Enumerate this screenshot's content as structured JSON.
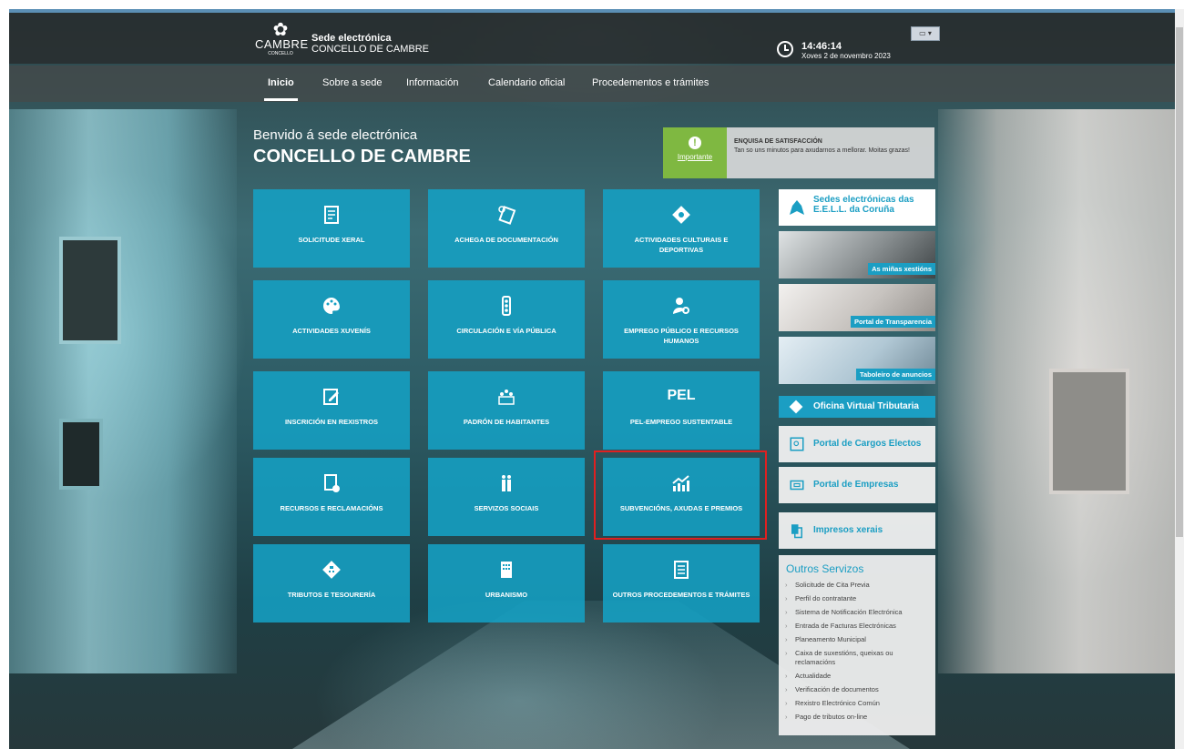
{
  "header": {
    "logo_text": "CAMBRE",
    "logo_sub": "CONCELLO",
    "site_title_1": "Sede electrónica",
    "site_title_2": "CONCELLO DE CAMBRE",
    "time": "14:46:14",
    "date": "Xoves 2 de novembro 2023",
    "language": "GL"
  },
  "nav": {
    "items": [
      "Inicio",
      "Sobre a sede",
      "Información",
      "Calendario oficial",
      "Procedementos e trámites"
    ]
  },
  "welcome": {
    "line1": "Benvido á sede electrónica",
    "line2": "CONCELLO DE CAMBRE"
  },
  "survey": {
    "badge": "Importante",
    "title": "ENQUISA DE SATISFACCIÓN",
    "text": "Tan so uns minutos para axudarnos a mellorar. Moitas grazas!"
  },
  "tiles": [
    {
      "label": "SOLICITUDE XERAL",
      "icon": "document-icon"
    },
    {
      "label": "ACHEGA DE DOCUMENTACIÓN",
      "icon": "documents-icon"
    },
    {
      "label": "ACTIVIDADES CULTURAIS E DEPORTIVAS",
      "icon": "ticket-icon"
    },
    {
      "label": "ACTIVIDADES XUVENÍS",
      "icon": "palette-icon"
    },
    {
      "label": "CIRCULACIÓN E VÍA PÚBLICA",
      "icon": "traffic-light-icon"
    },
    {
      "label": "EMPREGO PÚBLICO E RECURSOS HUMANOS",
      "icon": "user-search-icon"
    },
    {
      "label": "INSCRICIÓN EN REXISTROS",
      "icon": "edit-icon"
    },
    {
      "label": "PADRÓN DE HABITANTES",
      "icon": "people-icon"
    },
    {
      "label": "PEL-EMPREGO SUSTENTABLE",
      "icon": "pel-text-icon",
      "icon_text": "PEL"
    },
    {
      "label": "RECURSOS E RECLAMACIÓNS",
      "icon": "document-clock-icon"
    },
    {
      "label": "SERVIZOS SOCIAIS",
      "icon": "family-icon"
    },
    {
      "label": "SUBVENCIÓNS, AXUDAS E PREMIOS",
      "icon": "growth-chart-icon"
    },
    {
      "label": "TRIBUTOS E TESOURERÍA",
      "icon": "calculator-icon"
    },
    {
      "label": "URBANISMO",
      "icon": "building-icon"
    },
    {
      "label": "OUTROS PROCEDEMENTOS E TRÁMITES",
      "icon": "document-list-icon"
    }
  ],
  "sidebar": {
    "sedes": "Sedes electrónicas das E.E.L.L. da Coruña",
    "xestions": "As miñas xestións",
    "transparencia": "Portal de Transparencia",
    "taboleiro": "Taboleiro de anuncios",
    "oficina": "Oficina Virtual Tributaria",
    "cargos": "Portal de Cargos Electos",
    "empresas": "Portal de Empresas",
    "impresos": "Impresos xerais",
    "outros_title": "Outros Servizos",
    "outros": [
      "Solicitude de Cita Previa",
      "Perfil do contratante",
      "Sistema de Notificación Electrónica",
      "Entrada de Facturas Electrónicas",
      "Planeamento Municipal",
      "Caixa de suxestións, queixas ou reclamacións",
      "Actualidade",
      "Verificación de documentos",
      "Rexistro Electrónico Común",
      "Pago de tributos on-line"
    ]
  },
  "colors": {
    "tile": "#15a0c4",
    "accent": "#1b9ec3",
    "badge": "#7fb841",
    "highlight": "#e02020"
  }
}
